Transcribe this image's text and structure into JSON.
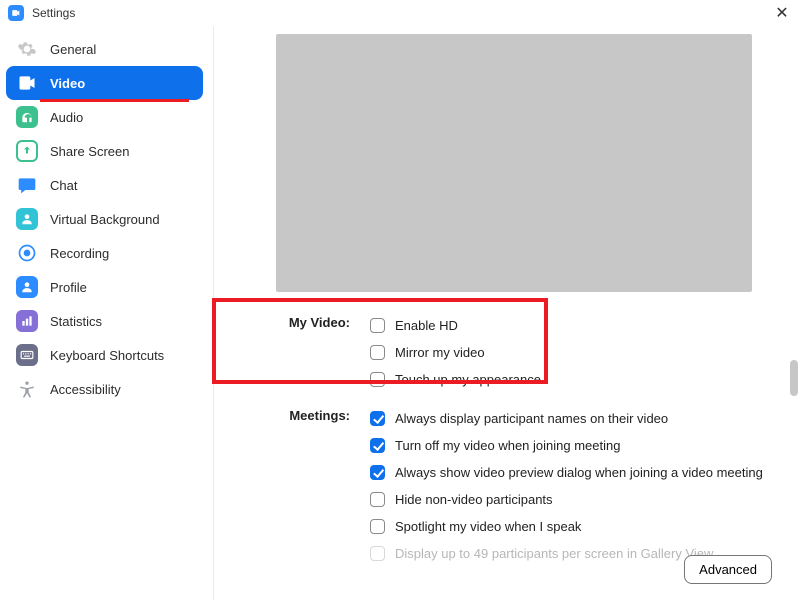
{
  "window": {
    "title": "Settings"
  },
  "sidebar": {
    "items": [
      {
        "label": "General"
      },
      {
        "label": "Video"
      },
      {
        "label": "Audio"
      },
      {
        "label": "Share Screen"
      },
      {
        "label": "Chat"
      },
      {
        "label": "Virtual Background"
      },
      {
        "label": "Recording"
      },
      {
        "label": "Profile"
      },
      {
        "label": "Statistics"
      },
      {
        "label": "Keyboard Shortcuts"
      },
      {
        "label": "Accessibility"
      }
    ]
  },
  "sections": {
    "my_video": {
      "label": "My Video:",
      "opts": [
        {
          "label": "Enable HD"
        },
        {
          "label": "Mirror my video"
        },
        {
          "label": "Touch up my appearance"
        }
      ]
    },
    "meetings": {
      "label": "Meetings:",
      "opts": [
        {
          "label": "Always display participant names on their video"
        },
        {
          "label": "Turn off my video when joining meeting"
        },
        {
          "label": "Always show video preview dialog when joining a video meeting"
        },
        {
          "label": "Hide non-video participants"
        },
        {
          "label": "Spotlight my video when I speak"
        },
        {
          "label": "Display up to 49 participants per screen in Gallery View"
        }
      ]
    }
  },
  "buttons": {
    "advanced": "Advanced"
  }
}
